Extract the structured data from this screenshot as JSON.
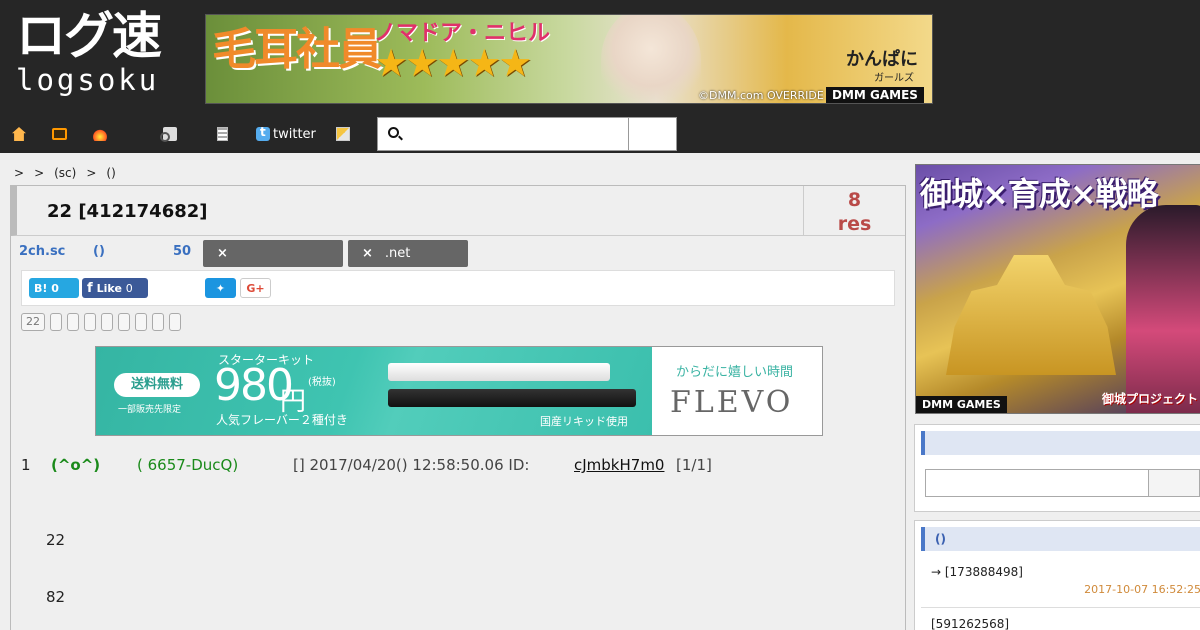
{
  "logo": {
    "jp": "ログ速",
    "en": "logsoku"
  },
  "top_banner": {
    "left_text": "毛耳社員",
    "character": "ノマドア・ニヒル",
    "stars": "★★★★★",
    "title": "かんぱに",
    "subtitle": "ガールズ",
    "copyright": "©DMM.com OVERRIDE",
    "brand": "DMM GAMES"
  },
  "nav": {
    "twitter_label": "twitter",
    "search_placeholder": ""
  },
  "breadcrumb": [
    ">",
    ">",
    "(sc)",
    ">",
    "()"
  ],
  "thread": {
    "title": "22  [412174682]",
    "res_count": "8",
    "res_label": "res"
  },
  "meta": {
    "board": "2ch.sc",
    "paren": "()",
    "count": "50",
    "tags": [
      {
        "x": "×",
        "label": ""
      },
      {
        "x": "×",
        "label": ".net"
      }
    ]
  },
  "social": {
    "hatena_label": "B!",
    "hatena_count": "0",
    "fb_label": "Like",
    "fb_count": "0",
    "gplus_label": "G+"
  },
  "page_tabs": [
    "22",
    "",
    "",
    "",
    "",
    "",
    "",
    "",
    ""
  ],
  "ad": {
    "pill": "送料無料",
    "note": "一部販売先限定",
    "kit": "スターターキット",
    "price": "980",
    "yen": "円",
    "tax": "(税抜)",
    "flavor": "人気フレーバー２種付き",
    "domestic": "国産リキッド使用",
    "slogan": "からだに嬉しい時間",
    "brand": "FLEVO"
  },
  "post": {
    "num": "1",
    "name": "(^o^)",
    "trip": "( 6657-DucQ)",
    "date": "[] 2017/04/20() 12:58:50.06 ID:",
    "id": "cJmbkH7m0",
    "count": "[1/1]",
    "lines": [
      "22",
      "82"
    ]
  },
  "side_ad": {
    "title": "御城×育成×戦略",
    "brand": "DMM GAMES",
    "logo": "御城プロジェクト"
  },
  "sidebar": {
    "search_head": "",
    "list_head": "()",
    "items": [
      {
        "text": "→ [173888498]",
        "date": "2017-10-07 16:52:25"
      },
      {
        "text": "[591262568]",
        "date": ""
      }
    ]
  },
  "colors": {
    "header_bg": "#262626",
    "accent_blue": "#3a70c0",
    "res_red": "#b94a48",
    "name_green": "#1a8a1a",
    "date_orange": "#d08a3a"
  }
}
